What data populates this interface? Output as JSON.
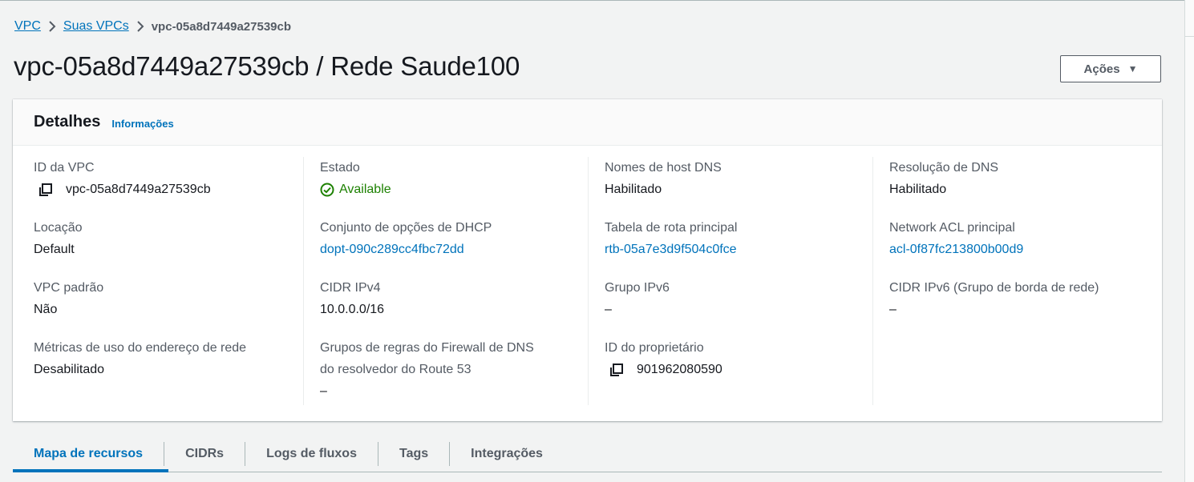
{
  "breadcrumb": {
    "items": [
      "VPC",
      "Suas VPCs"
    ],
    "current": "vpc-05a8d7449a27539cb"
  },
  "page": {
    "title": "vpc-05a8d7449a27539cb / Rede Saude100",
    "actions_label": "Ações"
  },
  "details": {
    "title": "Detalhes",
    "info_link": "Informações",
    "columns": [
      {
        "fields": [
          {
            "label": "ID da VPC",
            "value": "vpc-05a8d7449a27539cb",
            "copyable": true
          },
          {
            "label": "Locação",
            "value": "Default"
          },
          {
            "label": "VPC padrão",
            "value": "Não"
          },
          {
            "label": "Métricas de uso do endereço de rede",
            "value": "Desabilitado"
          }
        ]
      },
      {
        "fields": [
          {
            "label": "Estado",
            "value": "Available",
            "status": "success"
          },
          {
            "label": "Conjunto de opções de DHCP",
            "value": "dopt-090c289cc4fbc72dd",
            "link": true
          },
          {
            "label": "CIDR IPv4",
            "value": "10.0.0.0/16"
          },
          {
            "label_line1": "Grupos de regras do Firewall de DNS",
            "label_line2": "do resolvedor do Route 53",
            "value": "–"
          }
        ]
      },
      {
        "fields": [
          {
            "label": "Nomes de host DNS",
            "value": "Habilitado"
          },
          {
            "label": "Tabela de rota principal",
            "value": "rtb-05a7e3d9f504c0fce",
            "link": true
          },
          {
            "label": "Grupo IPv6",
            "value": "–"
          },
          {
            "label": "ID do proprietário",
            "value": "901962080590",
            "copyable": true
          }
        ]
      },
      {
        "fields": [
          {
            "label": "Resolução de DNS",
            "value": "Habilitado"
          },
          {
            "label": "Network ACL principal",
            "value": "acl-0f87fc213800b00d9",
            "link": true
          },
          {
            "label": "CIDR IPv6 (Grupo de borda de rede)",
            "value": "–"
          }
        ]
      }
    ]
  },
  "tabs": [
    "Mapa de recursos",
    "CIDRs",
    "Logs de fluxos",
    "Tags",
    "Integrações"
  ],
  "active_tab": "Mapa de recursos",
  "colors": {
    "link": "#0073bb",
    "success": "#1d8102",
    "text": "#16191f",
    "label": "#545b64",
    "page_bg": "#f2f3f3"
  },
  "icons": {
    "copy": "copy-icon",
    "status": "status-positive-icon",
    "breadcrumb_separator": "chevron-right-icon",
    "dropdown": "caret-down-icon"
  }
}
